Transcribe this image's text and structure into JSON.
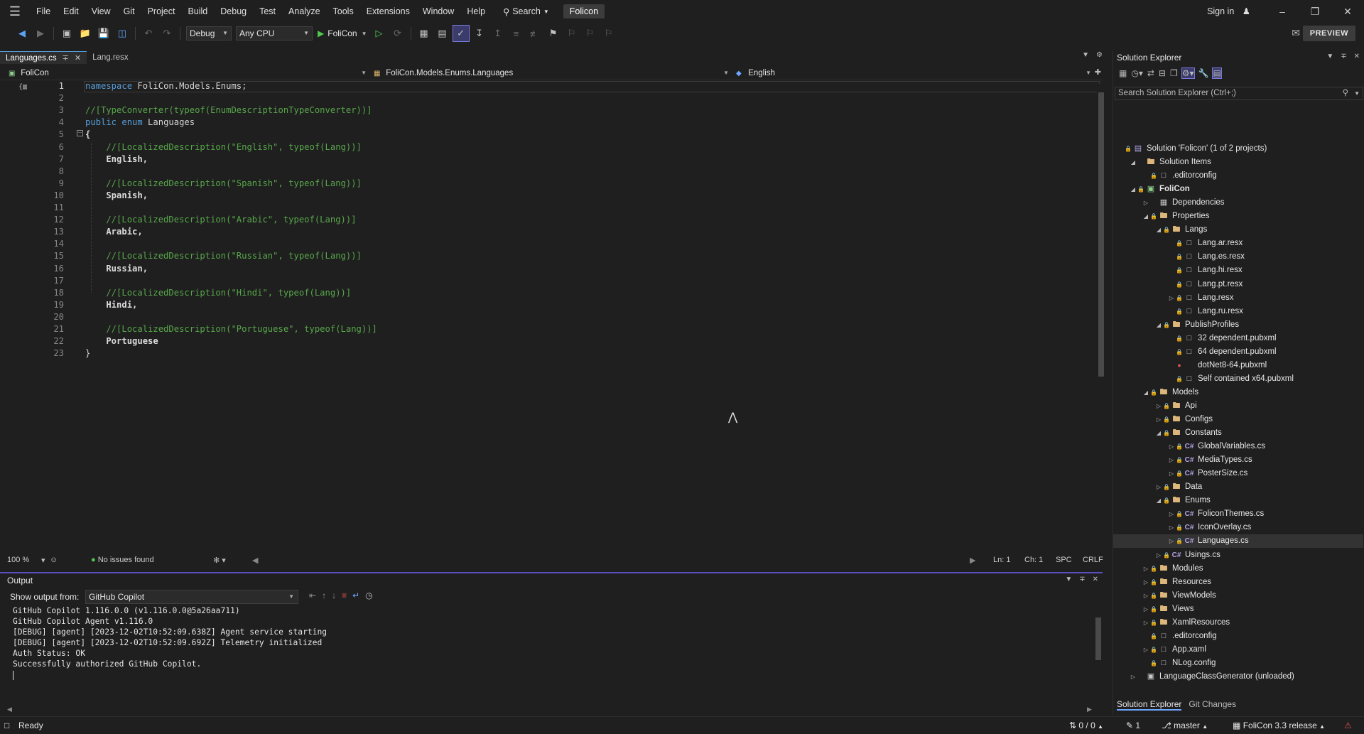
{
  "menubar": {
    "items": [
      "File",
      "Edit",
      "View",
      "Git",
      "Project",
      "Build",
      "Debug",
      "Test",
      "Analyze",
      "Tools",
      "Extensions",
      "Window",
      "Help"
    ],
    "search_label": "Search",
    "project_name": "Folicon",
    "sign_in": "Sign in"
  },
  "toolbar": {
    "configuration": "Debug",
    "platform": "Any CPU",
    "run_target": "FoliCon",
    "preview_label": "PREVIEW"
  },
  "tabs": [
    {
      "label": "Languages.cs",
      "active": true
    },
    {
      "label": "Lang.resx",
      "active": false
    }
  ],
  "navbar": {
    "project": "FoliCon",
    "type": "FoliCon.Models.Enums.Languages",
    "member": "English"
  },
  "editor": {
    "line_numbers": [
      "1",
      "2",
      "3",
      "4",
      "5",
      "6",
      "7",
      "8",
      "9",
      "10",
      "11",
      "12",
      "13",
      "14",
      "15",
      "16",
      "17",
      "18",
      "19",
      "20",
      "21",
      "22",
      "23"
    ],
    "lines": [
      {
        "kw": "namespace",
        "text": " FoliCon.Models.Enums;"
      },
      {
        "text": ""
      },
      {
        "comment": "//[TypeConverter(typeof(EnumDescriptionTypeConverter))]"
      },
      {
        "kw": "public enum",
        "text": " Languages"
      },
      {
        "text": "{"
      },
      {
        "comment": "    //[LocalizedDescription(\"English\", typeof(Lang))]"
      },
      {
        "text": "    English,"
      },
      {
        "text": ""
      },
      {
        "comment": "    //[LocalizedDescription(\"Spanish\", typeof(Lang))]"
      },
      {
        "text": "    Spanish,"
      },
      {
        "text": ""
      },
      {
        "comment": "    //[LocalizedDescription(\"Arabic\", typeof(Lang))]"
      },
      {
        "text": "    Arabic,"
      },
      {
        "text": ""
      },
      {
        "comment": "    //[LocalizedDescription(\"Russian\", typeof(Lang))]"
      },
      {
        "text": "    Russian,"
      },
      {
        "text": ""
      },
      {
        "comment": "    //[LocalizedDescription(\"Hindi\", typeof(Lang))]"
      },
      {
        "text": "    Hindi,"
      },
      {
        "text": ""
      },
      {
        "comment": "    //[LocalizedDescription(\"Portuguese\", typeof(Lang))]"
      },
      {
        "text": "    Portuguese"
      },
      {
        "text": "}"
      }
    ]
  },
  "editor_status": {
    "zoom": "100 %",
    "issues": "No issues found",
    "line": "Ln: 1",
    "col": "Ch: 1",
    "whitespace": "SPC",
    "line_ending": "CRLF"
  },
  "output": {
    "title": "Output",
    "show_from_label": "Show output from:",
    "source": "GitHub Copilot",
    "log": "GitHub Copilot 1.116.0.0 (v1.116.0.0@5a26aa711)\nGitHub Copilot Agent v1.116.0\n[DEBUG] [agent] [2023-12-02T10:52:09.638Z] Agent service starting\n[DEBUG] [agent] [2023-12-02T10:52:09.692Z] Telemetry initialized\nAuth Status: OK\nSuccessfully authorized GitHub Copilot."
  },
  "solution_explorer": {
    "title": "Solution Explorer",
    "search_placeholder": "Search Solution Explorer (Ctrl+;)",
    "bottom_tabs": [
      "Solution Explorer",
      "Git Changes"
    ],
    "tree": [
      {
        "label": "Solution 'Folicon' (1 of 2 projects)",
        "depth": 0,
        "exp": "",
        "lock": true,
        "icon": "sol"
      },
      {
        "label": "Solution Items",
        "depth": 1,
        "exp": "open",
        "lock": false,
        "icon": "folder"
      },
      {
        "label": ".editorconfig",
        "depth": 2,
        "exp": "",
        "lock": true,
        "icon": "file"
      },
      {
        "label": "FoliCon",
        "depth": 1,
        "exp": "open",
        "lock": true,
        "icon": "proj",
        "bold": true
      },
      {
        "label": "Dependencies",
        "depth": 2,
        "exp": "closed",
        "lock": false,
        "icon": "deps"
      },
      {
        "label": "Properties",
        "depth": 2,
        "exp": "open",
        "lock": true,
        "icon": "folder"
      },
      {
        "label": "Langs",
        "depth": 3,
        "exp": "open",
        "lock": true,
        "icon": "folder"
      },
      {
        "label": "Lang.ar.resx",
        "depth": 4,
        "exp": "",
        "lock": true,
        "icon": "file"
      },
      {
        "label": "Lang.es.resx",
        "depth": 4,
        "exp": "",
        "lock": true,
        "icon": "file"
      },
      {
        "label": "Lang.hi.resx",
        "depth": 4,
        "exp": "",
        "lock": true,
        "icon": "file"
      },
      {
        "label": "Lang.pt.resx",
        "depth": 4,
        "exp": "",
        "lock": true,
        "icon": "file"
      },
      {
        "label": "Lang.resx",
        "depth": 4,
        "exp": "closed",
        "lock": true,
        "icon": "file"
      },
      {
        "label": "Lang.ru.resx",
        "depth": 4,
        "exp": "",
        "lock": true,
        "icon": "file"
      },
      {
        "label": "PublishProfiles",
        "depth": 3,
        "exp": "open",
        "lock": true,
        "icon": "folder"
      },
      {
        "label": "32 dependent.pubxml",
        "depth": 4,
        "exp": "",
        "lock": true,
        "icon": "file"
      },
      {
        "label": "64 dependent.pubxml",
        "depth": 4,
        "exp": "",
        "lock": true,
        "icon": "file"
      },
      {
        "label": "dotNet8-64.pubxml",
        "depth": 4,
        "exp": "",
        "lock": false,
        "red": true,
        "icon": "none"
      },
      {
        "label": "Self contained x64.pubxml",
        "depth": 4,
        "exp": "",
        "lock": true,
        "icon": "file"
      },
      {
        "label": "Models",
        "depth": 2,
        "exp": "open",
        "lock": true,
        "icon": "folder"
      },
      {
        "label": "Api",
        "depth": 3,
        "exp": "closed",
        "lock": true,
        "icon": "folder"
      },
      {
        "label": "Configs",
        "depth": 3,
        "exp": "closed",
        "lock": true,
        "icon": "folder"
      },
      {
        "label": "Constants",
        "depth": 3,
        "exp": "open",
        "lock": true,
        "icon": "folder"
      },
      {
        "label": "GlobalVariables.cs",
        "depth": 4,
        "exp": "closed",
        "lock": true,
        "icon": "cs"
      },
      {
        "label": "MediaTypes.cs",
        "depth": 4,
        "exp": "closed",
        "lock": true,
        "icon": "cs"
      },
      {
        "label": "PosterSize.cs",
        "depth": 4,
        "exp": "closed",
        "lock": true,
        "icon": "cs"
      },
      {
        "label": "Data",
        "depth": 3,
        "exp": "closed",
        "lock": true,
        "icon": "folder"
      },
      {
        "label": "Enums",
        "depth": 3,
        "exp": "open",
        "lock": true,
        "icon": "folder"
      },
      {
        "label": "FoliconThemes.cs",
        "depth": 4,
        "exp": "closed",
        "lock": true,
        "icon": "cs"
      },
      {
        "label": "IconOverlay.cs",
        "depth": 4,
        "exp": "closed",
        "lock": true,
        "icon": "cs"
      },
      {
        "label": "Languages.cs",
        "depth": 4,
        "exp": "closed",
        "lock": true,
        "icon": "cs",
        "selected": true
      },
      {
        "label": "Usings.cs",
        "depth": 3,
        "exp": "closed",
        "lock": true,
        "icon": "cs"
      },
      {
        "label": "Modules",
        "depth": 2,
        "exp": "closed",
        "lock": true,
        "icon": "folder"
      },
      {
        "label": "Resources",
        "depth": 2,
        "exp": "closed",
        "lock": true,
        "icon": "folder"
      },
      {
        "label": "ViewModels",
        "depth": 2,
        "exp": "closed",
        "lock": true,
        "icon": "folder"
      },
      {
        "label": "Views",
        "depth": 2,
        "exp": "closed",
        "lock": true,
        "icon": "folder"
      },
      {
        "label": "XamlResources",
        "depth": 2,
        "exp": "closed",
        "lock": true,
        "icon": "folder"
      },
      {
        "label": ".editorconfig",
        "depth": 2,
        "exp": "",
        "lock": true,
        "icon": "file"
      },
      {
        "label": "App.xaml",
        "depth": 2,
        "exp": "closed",
        "lock": true,
        "icon": "file"
      },
      {
        "label": "NLog.config",
        "depth": 2,
        "exp": "",
        "lock": true,
        "icon": "file"
      },
      {
        "label": "LanguageClassGenerator (unloaded)",
        "depth": 1,
        "exp": "closed",
        "lock": false,
        "icon": "proj-unloaded"
      }
    ]
  },
  "statusbar": {
    "ready": "Ready",
    "sync": "0 / 0",
    "edits": "1",
    "branch": "master",
    "repo": "FoliCon 3.3 release"
  }
}
